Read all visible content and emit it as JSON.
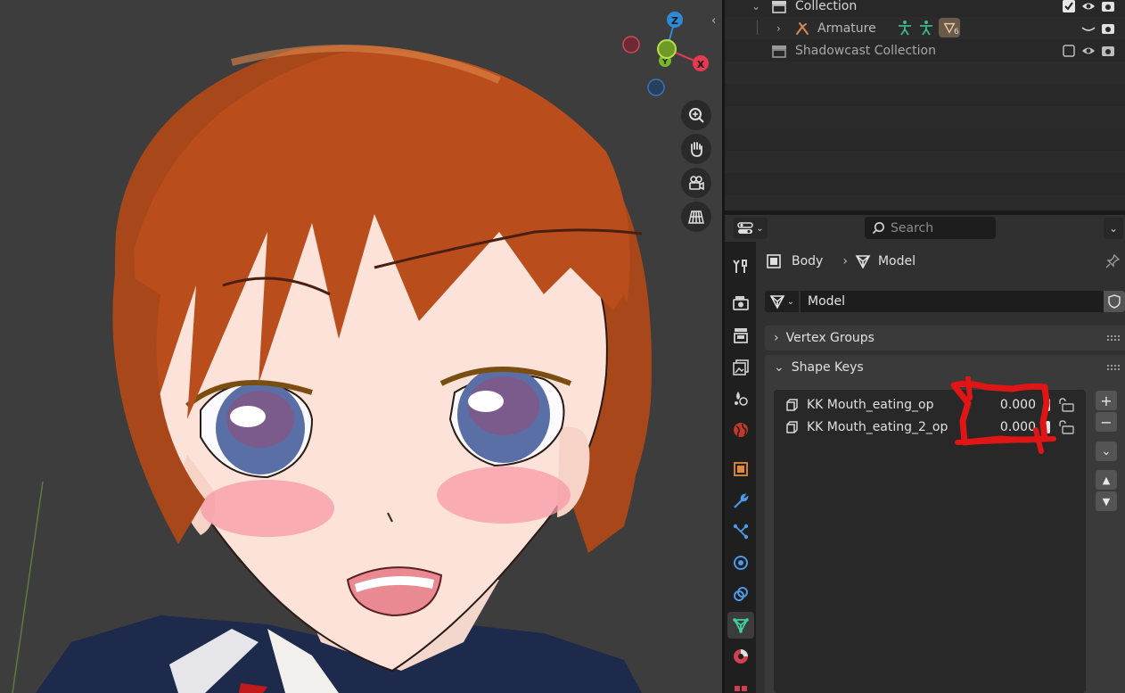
{
  "viewport": {
    "gizmo": {
      "z_label": "Z",
      "x_label": "X",
      "y_label": "Y"
    },
    "nav_tools": [
      "zoom-icon",
      "hand-pan-icon",
      "camera-view-icon",
      "ortho-grid-icon"
    ]
  },
  "outliner": {
    "rows": [
      {
        "label": "Collection",
        "icon": "collection-icon"
      },
      {
        "label": "Armature",
        "icon": "armature-icon",
        "child_count": "6"
      },
      {
        "label": "Shadowcast Collection",
        "icon": "collection-icon"
      }
    ]
  },
  "properties": {
    "search_placeholder": "Search",
    "breadcrumb": {
      "object": "Body",
      "data": "Model"
    },
    "mesh_data_name": "Model",
    "panels": {
      "vertex_groups": "Vertex Groups",
      "shape_keys": "Shape Keys"
    },
    "shape_keys": [
      {
        "name": "KK Mouth_eating_op",
        "value": "0.000"
      },
      {
        "name": "KK Mouth_eating_2_op",
        "value": "0.000"
      }
    ],
    "side_buttons": {
      "add": "+",
      "remove": "−",
      "specials": "⌄",
      "move_up": "▲",
      "move_down": "▼"
    }
  },
  "colors": {
    "accent_active_tab": "#3c3c3c",
    "mesh_data_green": "#3fd0a0",
    "annotation_red": "#e01515",
    "axis_x": "#e63a52",
    "axis_y": "#77b82a",
    "axis_z": "#2e8ad8"
  }
}
